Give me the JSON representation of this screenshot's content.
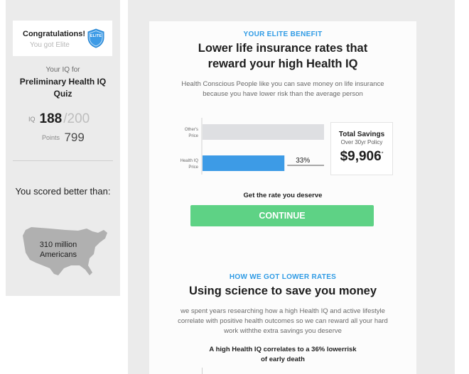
{
  "sidebar": {
    "elite_card": {
      "congrats": "Congratulations!",
      "subtitle": "You got Elite",
      "badge": "ELITE"
    },
    "iq_for": "Your IQ for",
    "quiz_title": "Preliminary Health IQ Quiz",
    "iq_label": "IQ",
    "iq_value": "188",
    "iq_max": "/200",
    "points_label": "Points",
    "points_value": "799",
    "scored_text": "You scored better than:",
    "americans_line1": "310 million",
    "americans_line2": "Americans"
  },
  "benefit": {
    "eyebrow": "YOUR ELITE BENEFIT",
    "headline_line1": "Lower life insurance rates that",
    "headline_line2": "reward your high Health IQ",
    "body": "Health Conscious People like you can save money on life insurance because you have lower risk than the average person",
    "savings_title": "Total Savings",
    "savings_sub": "Over 30yr Policy",
    "savings_amount": "$9,906",
    "savings_mark": "*",
    "get_rate": "Get the rate you deserve",
    "continue_label": "CONTINUE"
  },
  "rates": {
    "eyebrow": "HOW WE GOT LOWER RATES",
    "headline": "Using science to save you money",
    "body": "we spent years researching how a high Health IQ and active lifestyle correlate with positive health outcomes so we can reward all your hard work withthe extra savings you deserve",
    "correlates_line1": "A high Health IQ correlates to a 36% lowerrisk",
    "correlates_line2": "of early death"
  },
  "colors": {
    "accent_blue": "#2f9be5",
    "continue_green": "#5ed285",
    "others_bar": "#dedfe2",
    "healthiq_bar": "#3d9be6"
  },
  "chart_data": {
    "type": "bar",
    "orientation": "horizontal",
    "categories": [
      "Other's Price",
      "Health IQ Price"
    ],
    "values": [
      100,
      67
    ],
    "data_labels": [
      "",
      "33%"
    ],
    "xlim": [
      0,
      100
    ],
    "colors": [
      "#dedfe2",
      "#3d9be6"
    ]
  }
}
